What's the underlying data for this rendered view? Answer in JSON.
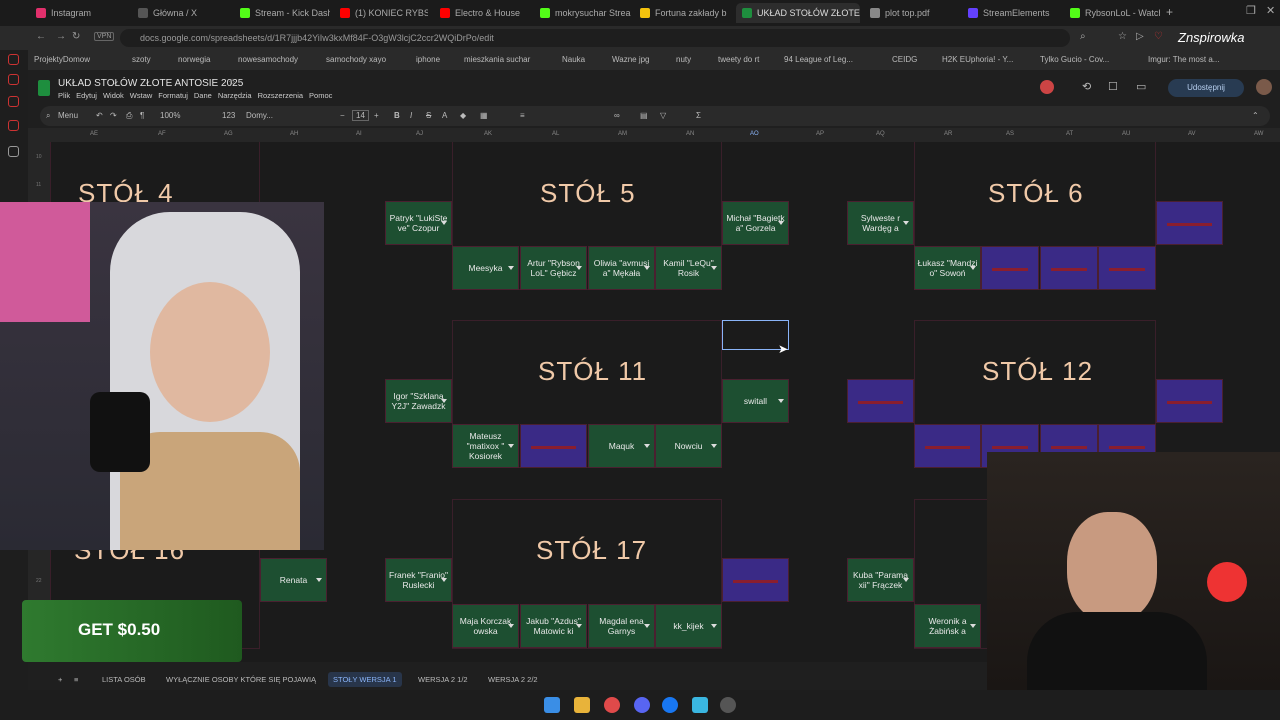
{
  "browser": {
    "tabs": [
      {
        "label": "Instagram",
        "color": "#e1306c"
      },
      {
        "label": "Główna / X",
        "color": "#555555"
      },
      {
        "label": "Stream - Kick Dash",
        "color": "#53fc18"
      },
      {
        "label": "(1) KONIEC RYBSO",
        "color": "#ff0000"
      },
      {
        "label": "Electro & House",
        "color": "#ff0000"
      },
      {
        "label": "mokrysuchar Strea",
        "color": "#53fc18"
      },
      {
        "label": "Fortuna zakłady b",
        "color": "#f4c20d"
      },
      {
        "label": "UKŁAD STOŁÓW ZŁOTE A",
        "color": "#1e8e3e"
      },
      {
        "label": "plot top.pdf",
        "color": "#888888"
      },
      {
        "label": "StreamElements",
        "color": "#6441ff"
      },
      {
        "label": "RybsonLoL - Watch",
        "color": "#53fc18"
      }
    ],
    "url": "docs.google.com/spreadsheets/d/1R7jjjb42YiIw3kxMf84F-O3gW3lcjC2ccr2WQiDrPo/edit",
    "vpn_label": "VPN",
    "bookmarks": [
      "ProjektyDomow",
      "szoty",
      "norwegia",
      "nowesamochody",
      "samochody xayo",
      "iphone",
      "mieszkania suchar",
      "Nauka",
      "Wazne jpg",
      "nuty",
      "tweety do rt",
      "94 League of Leg...",
      "CEIDG",
      "H2K EUphoria! - Y...",
      "Tylko Gucio - Cov...",
      "Imgur: The most a..."
    ],
    "watermark": "Znspirowka"
  },
  "sheets": {
    "title": "UKŁAD STOŁÓW ZŁOTE ANTOSIE 2025",
    "menus": [
      "Plik",
      "Edytuj",
      "Widok",
      "Wstaw",
      "Formatuj",
      "Dane",
      "Narzędzia",
      "Rozszerzenia",
      "Pomoc"
    ],
    "share_label": "Udostępnij",
    "toolbar": {
      "menu": "Menu",
      "zoom": "100%",
      "format": "123",
      "font": "Domy...",
      "size": "14"
    },
    "columns": [
      "AE",
      "AF",
      "AG",
      "AH",
      "AI",
      "AJ",
      "AK",
      "AL",
      "AM",
      "AN",
      "AO",
      "AP",
      "AQ",
      "AR",
      "AS",
      "AT",
      "AU",
      "AV",
      "AW"
    ],
    "rows": [
      "10",
      "11",
      "22"
    ],
    "sheet_tabs": [
      "LISTA OSÓB",
      "WYŁĄCZNIE OSOBY KTÓRE SIĘ POJAWIĄ",
      "STOŁY WERSJA 1",
      "WERSJA 2 1/2",
      "WERSJA 2 2/2"
    ],
    "active_sheet": "STOŁY WERSJA 1"
  },
  "tables": {
    "t4": {
      "title": "STÓŁ 4"
    },
    "t5": {
      "title": "STÓŁ 5",
      "left": "Patryk \"LukiSte ve\" Czopur",
      "right": "Michał \"Bagietk a\" Gorzela",
      "bottom": [
        "Meesyka",
        "Artur \"Rybson LoL\" Gębicz",
        "Oliwia \"avmusi a\" Mękała",
        "Kamil \"LeQu\" Rosik"
      ]
    },
    "t6": {
      "title": "STÓŁ 6",
      "left": "Sylweste r Wardęg a",
      "bottom": [
        "Łukasz \"Mandzi o\" Sowoń"
      ]
    },
    "t11": {
      "title": "STÓŁ 11",
      "left": "Igor \"Szklana Y2J\" Zawadzk",
      "right": "switall",
      "bottom": [
        "Mateusz \"matixox \" Kosiorek",
        "Maquk",
        "Nowciu"
      ]
    },
    "t12": {
      "title": "STÓŁ 12"
    },
    "t16": {
      "title": "STÓŁ 16",
      "right": "Renata"
    },
    "t17": {
      "title": "STÓŁ 17",
      "left": "Franek \"Franio\" Ruslecki",
      "bottom": [
        "Maja Korczak owska",
        "Jakub \"Azdus\" Matowic ki",
        "Magdal ena Garnys",
        "kk_kijek"
      ]
    },
    "t18": {
      "left": "Kuba \"Parama xii\" Frączek",
      "bottom": [
        "Weronik a Żabińsk a"
      ]
    }
  },
  "promo": {
    "text": "GET $0.50"
  },
  "colors": {
    "green_cell": "#1d4f31",
    "purple_cell": "#3a2a86",
    "title": "#f0c9a8"
  }
}
